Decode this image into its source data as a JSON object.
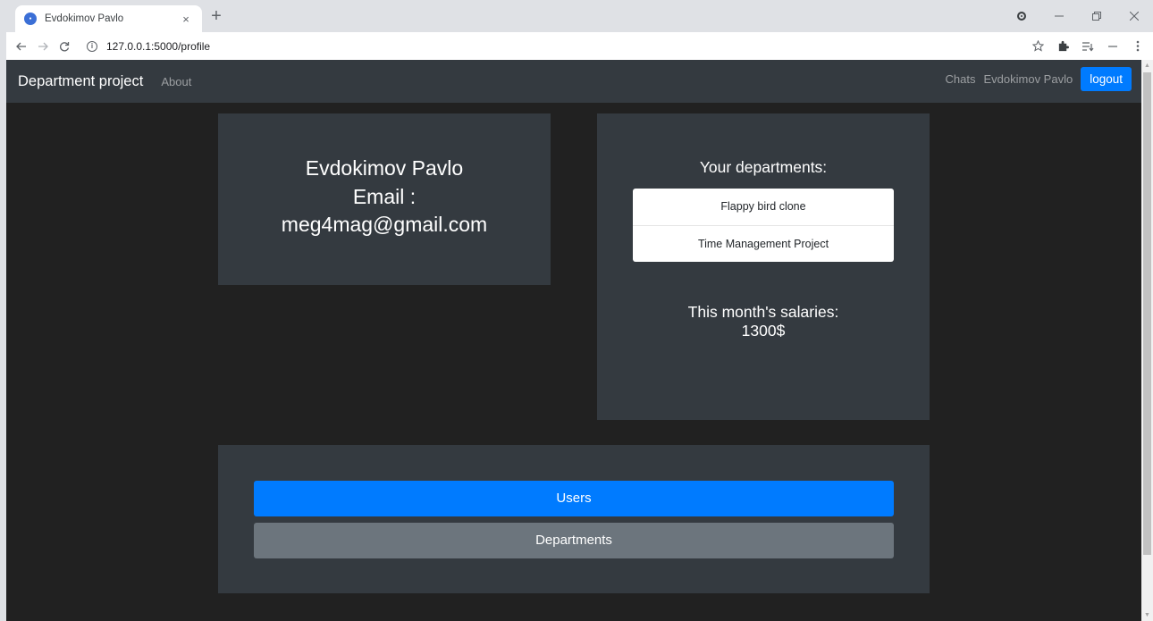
{
  "browser": {
    "tab_title": "Evdokimov Pavlo",
    "tab_close": "×",
    "new_tab": "+",
    "url": "127.0.0.1:5000/profile",
    "icons": [
      "back-icon",
      "forward-icon",
      "reload-icon",
      "info-icon",
      "star-icon",
      "extensions-icon",
      "reading-list-icon",
      "menu-icon"
    ]
  },
  "navbar": {
    "brand": "Department project",
    "about": "About",
    "chats": "Chats",
    "user": "Evdokimov Pavlo",
    "logout": "logout"
  },
  "profile": {
    "name": "Evdokimov Pavlo",
    "email_label": "Email :",
    "email": "meg4mag@gmail.com"
  },
  "departments": {
    "title": "Your departments:",
    "items": [
      "Flappy bird clone",
      "Time Management Project"
    ],
    "salary_label": "This month's salaries:",
    "salary_value": "1300$"
  },
  "actions": {
    "users": "Users",
    "departments": "Departments"
  },
  "colors": {
    "page_bg": "#212121",
    "card_bg": "#343a40",
    "primary": "#007bff",
    "secondary": "#6c757d"
  }
}
